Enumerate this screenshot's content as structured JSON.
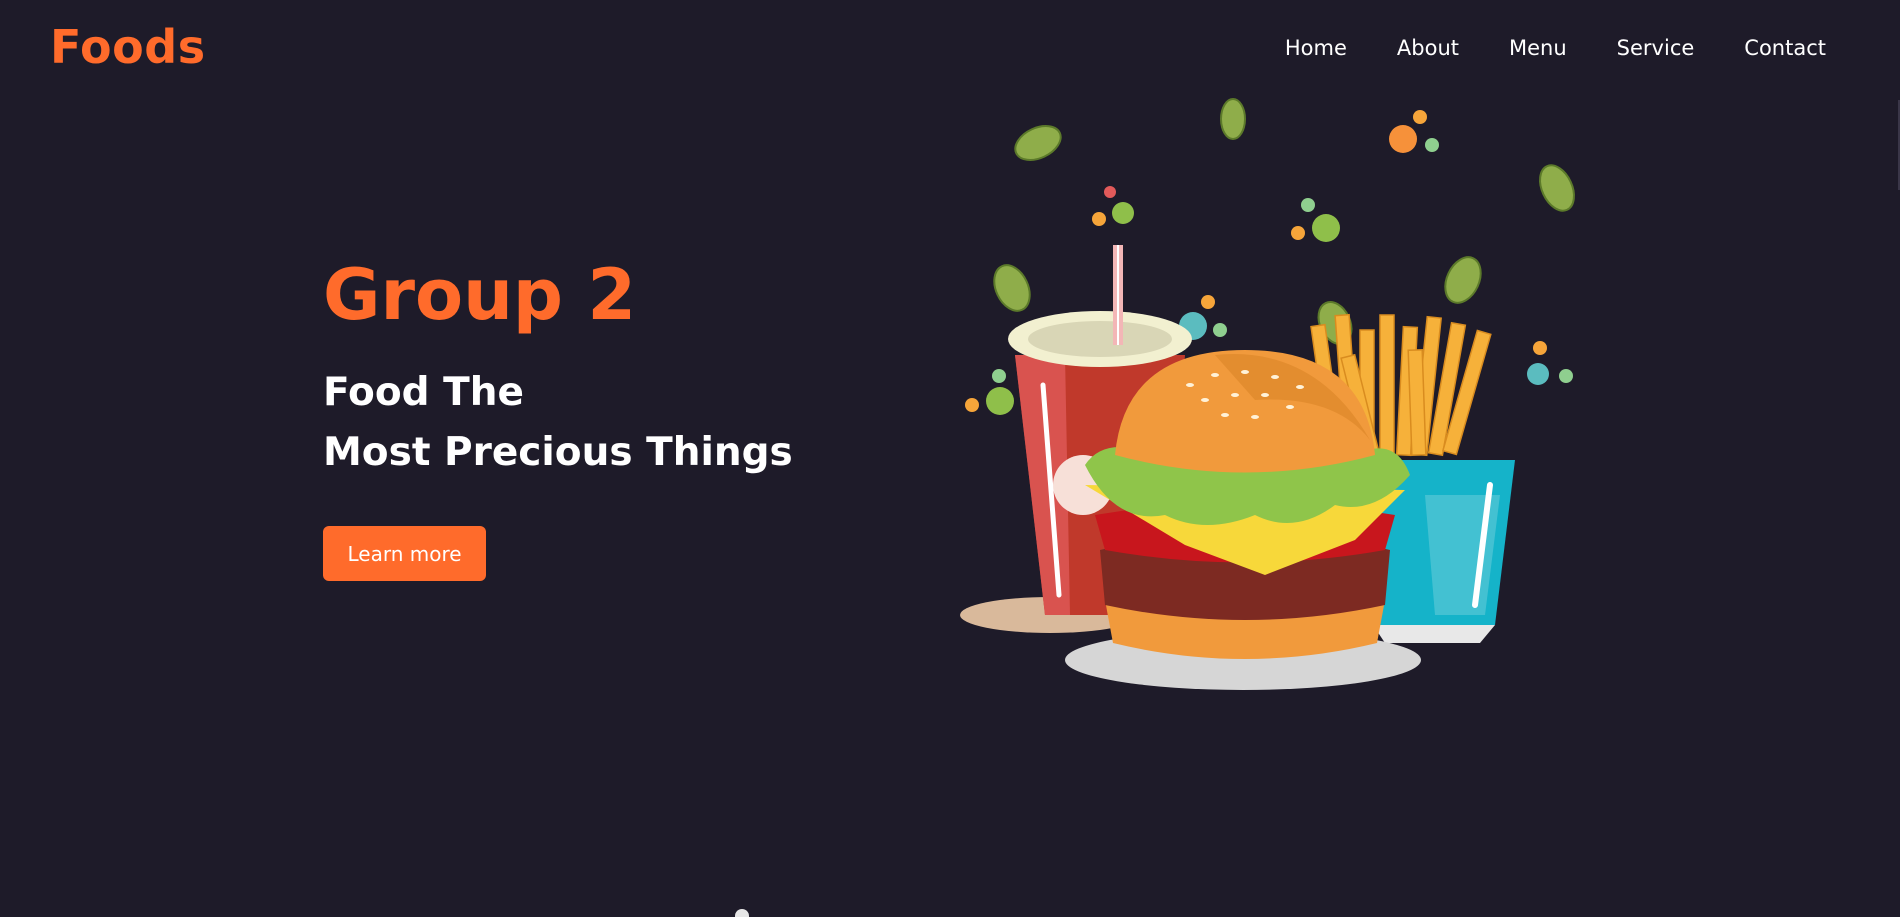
{
  "header": {
    "logo": "Foods",
    "nav": [
      "Home",
      "About",
      "Menu",
      "Service",
      "Contact"
    ]
  },
  "hero": {
    "title": "Group 2",
    "subtitle_line1": "Food The",
    "subtitle_line2": "Most Precious Things",
    "button": "Learn more",
    "illustration": "burger-fries-drink-illustration"
  },
  "colors": {
    "background": "#1e1b29",
    "accent": "#ff6b2b",
    "text": "#ffffff"
  }
}
